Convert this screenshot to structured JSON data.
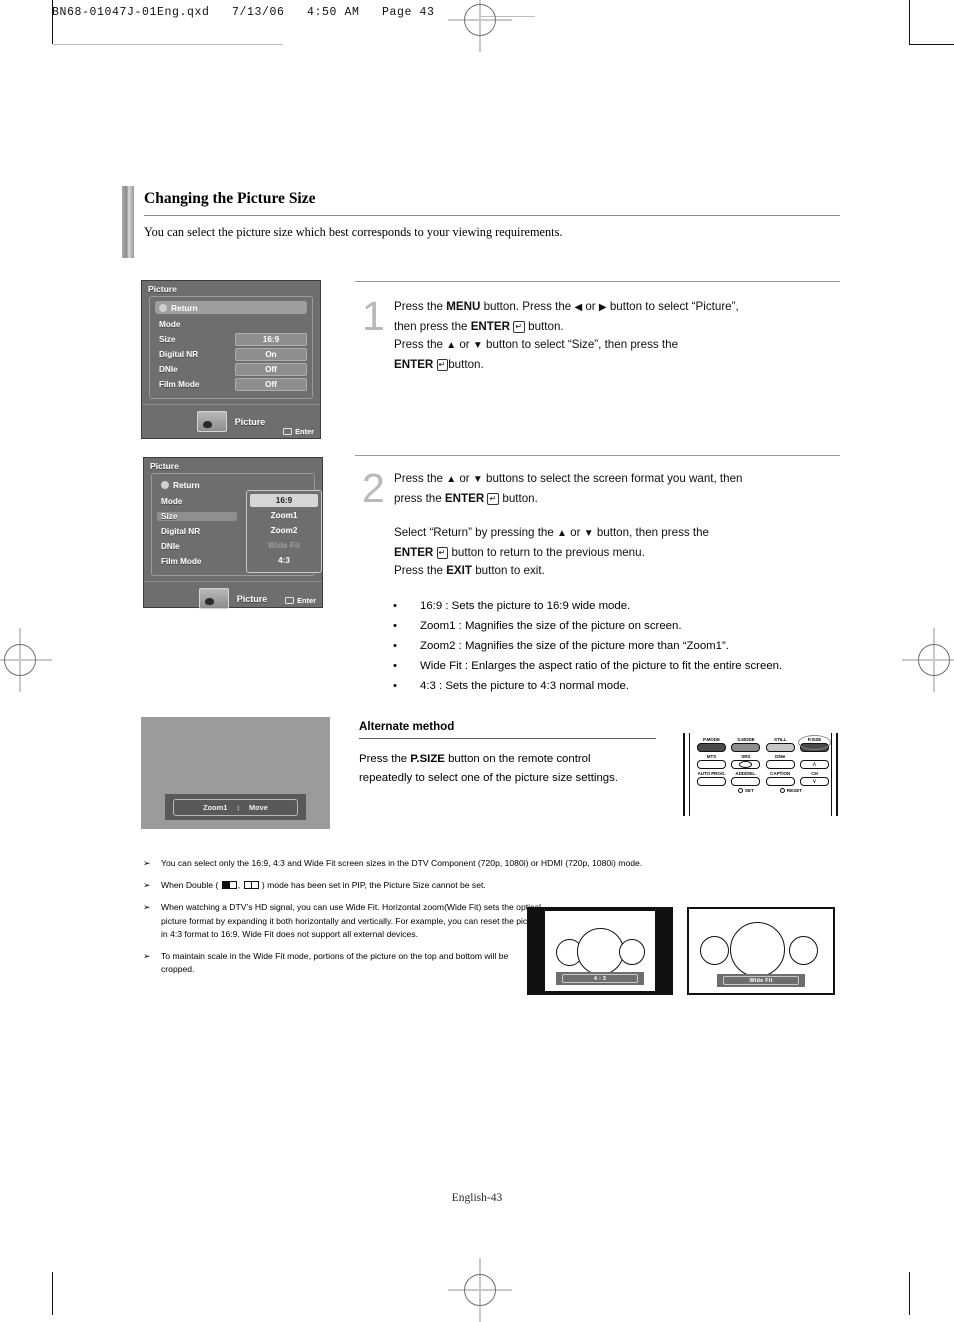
{
  "print": {
    "header": "BN68-01047J-01Eng.qxd   7/13/06   4:50 AM   Page 43"
  },
  "section": {
    "title": "Changing the Picture Size",
    "intro": "You can select the picture size which best corresponds to your viewing requirements."
  },
  "osd1": {
    "header": "Picture",
    "return_label": "Return",
    "rows": [
      {
        "label": "Mode",
        "value": ""
      },
      {
        "label": "Size",
        "value": "16:9"
      },
      {
        "label": "Digital NR",
        "value": "On"
      },
      {
        "label": "DNIe",
        "value": "Off"
      },
      {
        "label": "Film Mode",
        "value": "Off"
      }
    ],
    "footer_label": "Picture",
    "enter_label": "Enter"
  },
  "osd2": {
    "header": "Picture",
    "return_label": "Return",
    "rows": [
      {
        "label": "Mode"
      },
      {
        "label": "Size"
      },
      {
        "label": "Digital NR"
      },
      {
        "label": "DNIe"
      },
      {
        "label": "Film Mode"
      }
    ],
    "dropdown": [
      {
        "label": "16:9",
        "state": "selected"
      },
      {
        "label": "Zoom1",
        "state": "normal"
      },
      {
        "label": "Zoom2",
        "state": "normal"
      },
      {
        "label": "Wide Fit",
        "state": "disabled"
      },
      {
        "label": "4:3",
        "state": "normal"
      }
    ],
    "footer_label": "Picture",
    "enter_label": "Enter"
  },
  "steps": [
    {
      "number": "1",
      "lines": [
        "Press the MENU button. Press the ◀ or ▶ button to select “Picture”,",
        "then press the ENTER button.",
        "Press the ▲ or ▼ button to select “Size”, then press the",
        "ENTER button."
      ]
    },
    {
      "number": "2",
      "lines": [
        "Press the ▲ or ▼ buttons to select the screen format you want, then",
        "press the ENTER button.",
        "Select “Return” by pressing the ▲ or ▼ button, then press the",
        "ENTER button to return to the previous menu.",
        "Press the EXIT button to exit."
      ]
    }
  ],
  "bullets": [
    "16:9 : Sets the picture to 16:9 wide mode.",
    "Zoom1 : Magnifies the size of the picture on screen.",
    "Zoom2 : Magnifies the size of the picture more than “Zoom1”.",
    "Wide Fit : Enlarges the aspect ratio of the picture to fit the entire screen.",
    "4:3 : Sets the picture to 4:3 normal mode."
  ],
  "alternate": {
    "title": "Alternate method",
    "line1_a": "Press the ",
    "line1_b": "P.SIZE",
    "line1_c": " button on the remote control",
    "line2": "repeatedly to select one of the picture size settings."
  },
  "graybox": {
    "mode_label": "Zoom1",
    "action_label": "Move"
  },
  "remote": {
    "row1": [
      "P.MODE",
      "S.MODE",
      "STILL",
      "P.SIZE"
    ],
    "row2": [
      "MTS",
      "SRS",
      "DNIe",
      "∧"
    ],
    "row3": [
      "AUTO PROG.",
      "ADD/DEL.",
      "CAPTION",
      "CH"
    ],
    "row3_arrow": "∨",
    "bottom": [
      "SET",
      "RESET"
    ]
  },
  "notes": [
    {
      "marker": "➢",
      "text": "You can select only the 16:9, 4:3 and Wide Fit screen sizes in the DTV Component (720p, 1080i) or HDMI (720p, 1080i) mode."
    },
    {
      "marker": "➢",
      "text_before": "When Double (",
      "text_mid": ",",
      "text_after": ") mode has been set in PIP, the Picture Size cannot be set."
    },
    {
      "marker": "➢",
      "text": "When watching a DTV’s HD signal, you can use Wide Fit. Horizontal zoom(Wide Fit) sets the optical picture format by expanding it both horizontally and vertically. For example, you can reset the picture in 4:3 format to 16:9. Wide Fit does not support all external devices."
    },
    {
      "marker": "➢",
      "text": "To maintain scale in the Wide Fit mode, portions of the picture on the top and bottom will be cropped."
    }
  ],
  "figures": [
    {
      "name": "4 : 3"
    },
    {
      "name": "Wide Fit"
    }
  ],
  "footer": {
    "page": "English-43"
  }
}
